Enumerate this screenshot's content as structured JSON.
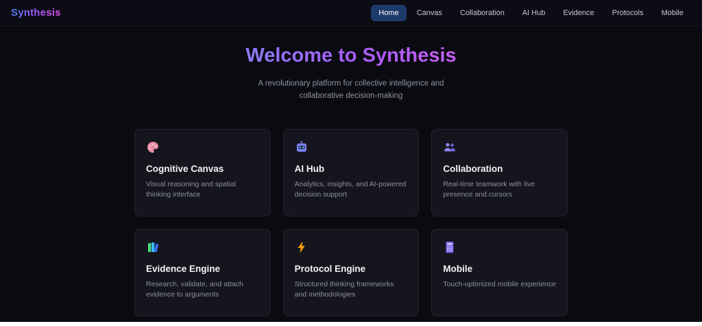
{
  "brand": {
    "name": "Synthesis"
  },
  "nav": {
    "items": [
      {
        "label": "Home",
        "active": true
      },
      {
        "label": "Canvas",
        "active": false
      },
      {
        "label": "Collaboration",
        "active": false
      },
      {
        "label": "AI Hub",
        "active": false
      },
      {
        "label": "Evidence",
        "active": false
      },
      {
        "label": "Protocols",
        "active": false
      },
      {
        "label": "Mobile",
        "active": false
      }
    ]
  },
  "hero": {
    "title": "Welcome to Synthesis",
    "subtitle": "A revolutionary platform for collective intelligence and collaborative decision-making"
  },
  "cards": [
    {
      "icon": "palette-icon",
      "title": "Cognitive Canvas",
      "description": "Visual reasoning and spatial thinking interface"
    },
    {
      "icon": "robot-icon",
      "title": "AI Hub",
      "description": "Analytics, insights, and AI-powered decision support"
    },
    {
      "icon": "people-icon",
      "title": "Collaboration",
      "description": "Real-time teamwork with live presence and cursors"
    },
    {
      "icon": "books-icon",
      "title": "Evidence Engine",
      "description": "Research, validate, and attach evidence to arguments"
    },
    {
      "icon": "lightning-icon",
      "title": "Protocol Engine",
      "description": "Structured thinking frameworks and methodologies"
    },
    {
      "icon": "phone-icon",
      "title": "Mobile",
      "description": "Touch-optimized mobile experience"
    }
  ],
  "colors": {
    "page_background": "#0a0a11",
    "card_background": "#15151d",
    "active_nav_background": "#1e3a6b",
    "accent_purple": "#a855f7"
  }
}
